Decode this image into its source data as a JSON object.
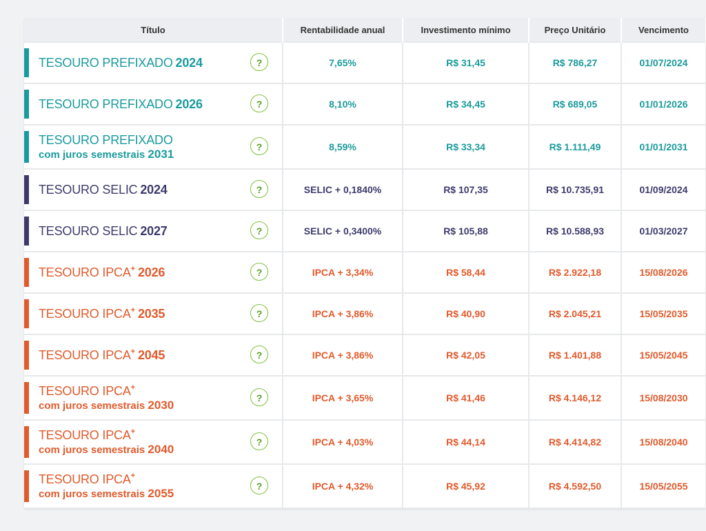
{
  "table": {
    "headers": [
      "Título",
      "Rentabilidade anual",
      "Investimento mínimo",
      "Preço Unitário",
      "Vencimento"
    ],
    "help_glyph": "?",
    "rows": [
      {
        "name": "TESOURO PREFIXADO",
        "plus": "",
        "sub": "",
        "year": "2024",
        "rent": "7,65%",
        "min": "R$ 31,45",
        "price": "R$ 786,27",
        "venc": "01/07/2024",
        "color": "#1a9a9c"
      },
      {
        "name": "TESOURO PREFIXADO",
        "plus": "",
        "sub": "",
        "year": "2026",
        "rent": "8,10%",
        "min": "R$ 34,45",
        "price": "R$ 689,05",
        "venc": "01/01/2026",
        "color": "#1a9a9c"
      },
      {
        "name": "TESOURO PREFIXADO",
        "plus": "",
        "sub": "com juros semestrais",
        "year": "2031",
        "rent": "8,59%",
        "min": "R$ 33,34",
        "price": "R$ 1.111,49",
        "venc": "01/01/2031",
        "color": "#1a9a9c"
      },
      {
        "name": "TESOURO SELIC",
        "plus": "",
        "sub": "",
        "year": "2024",
        "rent": "SELIC + 0,1840%",
        "min": "R$ 107,35",
        "price": "R$ 10.735,91",
        "venc": "01/09/2024",
        "color": "#3d3a6b"
      },
      {
        "name": "TESOURO SELIC",
        "plus": "",
        "sub": "",
        "year": "2027",
        "rent": "SELIC + 0,3400%",
        "min": "R$ 105,88",
        "price": "R$ 10.588,93",
        "venc": "01/03/2027",
        "color": "#3d3a6b"
      },
      {
        "name": "TESOURO IPCA",
        "plus": "+",
        "sub": "",
        "year": "2026",
        "rent": "IPCA + 3,34%",
        "min": "R$ 58,44",
        "price": "R$ 2.922,18",
        "venc": "15/08/2026",
        "color": "#e05a2b"
      },
      {
        "name": "TESOURO IPCA",
        "plus": "+",
        "sub": "",
        "year": "2035",
        "rent": "IPCA + 3,86%",
        "min": "R$ 40,90",
        "price": "R$ 2.045,21",
        "venc": "15/05/2035",
        "color": "#e05a2b"
      },
      {
        "name": "TESOURO IPCA",
        "plus": "+",
        "sub": "",
        "year": "2045",
        "rent": "IPCA + 3,86%",
        "min": "R$ 42,05",
        "price": "R$ 1.401,88",
        "venc": "15/05/2045",
        "color": "#e05a2b"
      },
      {
        "name": "TESOURO IPCA",
        "plus": "+",
        "sub": "com juros semestrais",
        "year": "2030",
        "rent": "IPCA + 3,65%",
        "min": "R$ 41,46",
        "price": "R$ 4.146,12",
        "venc": "15/08/2030",
        "color": "#e05a2b"
      },
      {
        "name": "TESOURO IPCA",
        "plus": "+",
        "sub": "com juros semestrais",
        "year": "2040",
        "rent": "IPCA + 4,03%",
        "min": "R$ 44,14",
        "price": "R$ 4.414,82",
        "venc": "15/08/2040",
        "color": "#e05a2b"
      },
      {
        "name": "TESOURO IPCA",
        "plus": "+",
        "sub": "com juros semestrais",
        "year": "2055",
        "rent": "IPCA + 4,32%",
        "min": "R$ 45,92",
        "price": "R$ 4.592,50",
        "venc": "15/05/2055",
        "color": "#e05a2b"
      }
    ]
  }
}
